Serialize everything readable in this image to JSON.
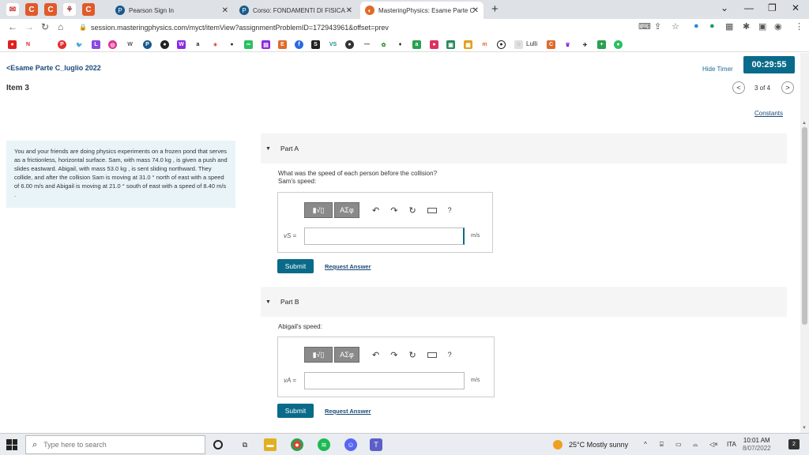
{
  "browser": {
    "tabs": [
      {
        "label": "Pearson Sign In"
      },
      {
        "label": "Corso: FONDAMENTI DI FISICA"
      },
      {
        "label": "MasteringPhysics: Esame Parte C"
      }
    ],
    "url": "session.masteringphysics.com/myct/itemView?assignmentProblemID=172943961&offset=prev",
    "bookmark_text": "Lulli"
  },
  "header": {
    "breadcrumb": "<Esame Parte C_luglio 2022",
    "item_title": "Item 3",
    "hide_timer": "Hide Timer",
    "timer": "00:29:55",
    "pager": "3 of 4",
    "constants": "Constants"
  },
  "problem": {
    "text": "You and your friends are doing physics experiments on a frozen pond that serves as a frictionless, horizontal surface. Sam, with mass 74.0 kg , is given a push and slides eastward. Abigail, with mass 53.0 kg , is sent sliding northward. They collide, and after the collision Sam is moving at 31.0 ° north of east with a speed of 6.00 m/s and Abigail is moving at 21.0 ° south of east with a speed of 8.40 m/s ."
  },
  "partA": {
    "label": "Part A",
    "question": "What was the speed of each person before the collision?",
    "sub": "Sam's speed:",
    "var": "vS =",
    "units": "m/s",
    "submit": "Submit",
    "request": "Request Answer"
  },
  "partB": {
    "label": "Part B",
    "sub": "Abigail's speed:",
    "var": "vA =",
    "units": "m/s",
    "submit": "Submit",
    "request": "Request Answer"
  },
  "toolbar": {
    "templates": "▮√▯",
    "symbols": "ΑΣφ",
    "help": "?"
  },
  "taskbar": {
    "search_placeholder": "Type here to search",
    "weather": "25°C  Mostly sunny",
    "lang": "ITA",
    "time": "10:01 AM",
    "date": "8/07/2022",
    "notif_count": "2"
  }
}
